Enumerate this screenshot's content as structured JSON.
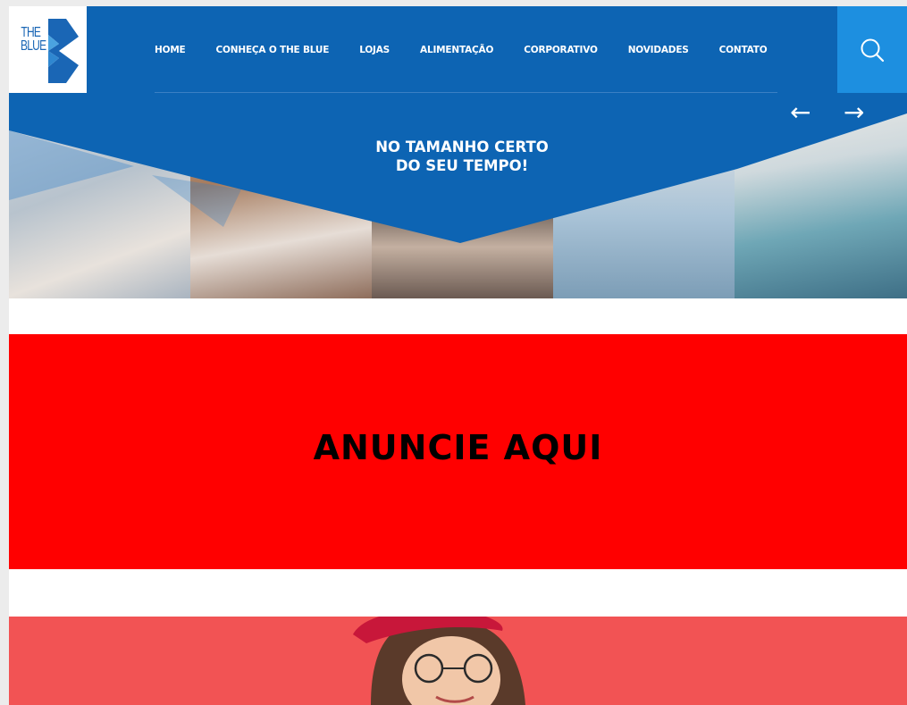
{
  "header": {
    "logo": {
      "line1": "THE",
      "line2": "BLUE"
    },
    "nav": [
      {
        "label": "HOME"
      },
      {
        "label": "CONHEÇA O THE BLUE"
      },
      {
        "label": "LOJAS"
      },
      {
        "label": "ALIMENTAÇÃO"
      },
      {
        "label": "CORPORATIVO"
      },
      {
        "label": "NOVIDADES"
      },
      {
        "label": "CONTATO"
      }
    ],
    "search_icon": "search-icon"
  },
  "hero": {
    "title_line1": "NO TAMANHO CERTO",
    "title_line2": "DO SEU TEMPO!",
    "prev_arrow": "←",
    "next_arrow": "→"
  },
  "ad": {
    "label": "ANUNCIE AQUI"
  },
  "colors": {
    "brand_blue": "#0d64b3",
    "search_blue": "#1d8fe0",
    "ad_red": "#ff0000",
    "banner_coral": "#f25354"
  }
}
